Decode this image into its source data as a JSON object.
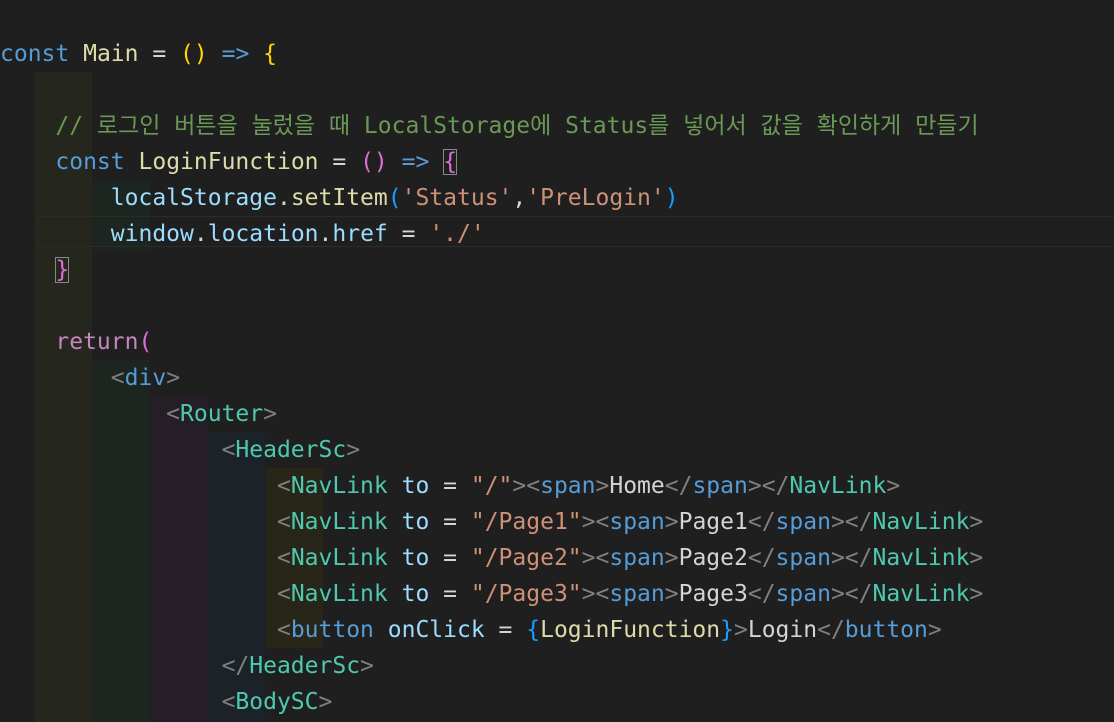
{
  "editor": {
    "lines": [
      {
        "indent": "",
        "tokens": [
          {
            "t": "const",
            "c": "kw"
          },
          {
            "t": " ",
            "c": "op"
          },
          {
            "t": "Main",
            "c": "fn"
          },
          {
            "t": " = ",
            "c": "op"
          },
          {
            "t": "()",
            "c": "b1"
          },
          {
            "t": " ",
            "c": "op"
          },
          {
            "t": "=>",
            "c": "kw"
          },
          {
            "t": " ",
            "c": "op"
          },
          {
            "t": "{",
            "c": "b1"
          }
        ]
      },
      {
        "indent": "",
        "tokens": []
      },
      {
        "indent": "    ",
        "tokens": [
          {
            "t": "// 로그인 버튼을 눌렀을 때 LocalStorage에 Status를 넣어서 값을 확인하게 만들기",
            "c": "com"
          }
        ]
      },
      {
        "indent": "    ",
        "tokens": [
          {
            "t": "const",
            "c": "kw"
          },
          {
            "t": " ",
            "c": "op"
          },
          {
            "t": "LoginFunction",
            "c": "fn"
          },
          {
            "t": " = ",
            "c": "op"
          },
          {
            "t": "()",
            "c": "b2"
          },
          {
            "t": " ",
            "c": "op"
          },
          {
            "t": "=>",
            "c": "kw"
          },
          {
            "t": " ",
            "c": "op"
          },
          {
            "t": "{",
            "c": "b2",
            "m": true
          }
        ]
      },
      {
        "indent": "        ",
        "tokens": [
          {
            "t": "localStorage",
            "c": "var"
          },
          {
            "t": ".",
            "c": "op"
          },
          {
            "t": "setItem",
            "c": "fn"
          },
          {
            "t": "(",
            "c": "b3"
          },
          {
            "t": "'Status'",
            "c": "str"
          },
          {
            "t": ",",
            "c": "op"
          },
          {
            "t": "'PreLogin'",
            "c": "str"
          },
          {
            "t": ")",
            "c": "b3"
          }
        ]
      },
      {
        "indent": "        ",
        "tokens": [
          {
            "t": "window",
            "c": "var"
          },
          {
            "t": ".",
            "c": "op"
          },
          {
            "t": "location",
            "c": "var"
          },
          {
            "t": ".",
            "c": "op"
          },
          {
            "t": "href",
            "c": "var"
          },
          {
            "t": " = ",
            "c": "op"
          },
          {
            "t": "'./'",
            "c": "str"
          }
        ]
      },
      {
        "indent": "    ",
        "tokens": [
          {
            "t": "}",
            "c": "b2",
            "m": true
          }
        ]
      },
      {
        "indent": "",
        "tokens": []
      },
      {
        "indent": "    ",
        "tokens": [
          {
            "t": "return",
            "c": "ctrl"
          },
          {
            "t": "(",
            "c": "b2"
          }
        ]
      },
      {
        "indent": "        ",
        "tokens": [
          {
            "t": "<",
            "c": "punc"
          },
          {
            "t": "div",
            "c": "tag"
          },
          {
            "t": ">",
            "c": "punc"
          }
        ]
      },
      {
        "indent": "            ",
        "tokens": [
          {
            "t": "<",
            "c": "punc"
          },
          {
            "t": "Router",
            "c": "comp"
          },
          {
            "t": ">",
            "c": "punc"
          }
        ]
      },
      {
        "indent": "                ",
        "tokens": [
          {
            "t": "<",
            "c": "punc"
          },
          {
            "t": "HeaderSc",
            "c": "comp"
          },
          {
            "t": ">",
            "c": "punc"
          }
        ]
      },
      {
        "indent": "                    ",
        "tokens": [
          {
            "t": "<",
            "c": "punc"
          },
          {
            "t": "NavLink",
            "c": "comp"
          },
          {
            "t": " ",
            "c": "op"
          },
          {
            "t": "to",
            "c": "var"
          },
          {
            "t": " = ",
            "c": "op"
          },
          {
            "t": "\"/\"",
            "c": "str"
          },
          {
            "t": "><",
            "c": "punc"
          },
          {
            "t": "span",
            "c": "tag"
          },
          {
            "t": ">",
            "c": "punc"
          },
          {
            "t": "Home",
            "c": "text"
          },
          {
            "t": "</",
            "c": "punc"
          },
          {
            "t": "span",
            "c": "tag"
          },
          {
            "t": "></",
            "c": "punc"
          },
          {
            "t": "NavLink",
            "c": "comp"
          },
          {
            "t": ">",
            "c": "punc"
          }
        ]
      },
      {
        "indent": "                    ",
        "tokens": [
          {
            "t": "<",
            "c": "punc"
          },
          {
            "t": "NavLink",
            "c": "comp"
          },
          {
            "t": " ",
            "c": "op"
          },
          {
            "t": "to",
            "c": "var"
          },
          {
            "t": " = ",
            "c": "op"
          },
          {
            "t": "\"/Page1\"",
            "c": "str"
          },
          {
            "t": "><",
            "c": "punc"
          },
          {
            "t": "span",
            "c": "tag"
          },
          {
            "t": ">",
            "c": "punc"
          },
          {
            "t": "Page1",
            "c": "text"
          },
          {
            "t": "</",
            "c": "punc"
          },
          {
            "t": "span",
            "c": "tag"
          },
          {
            "t": "></",
            "c": "punc"
          },
          {
            "t": "NavLink",
            "c": "comp"
          },
          {
            "t": ">",
            "c": "punc"
          }
        ]
      },
      {
        "indent": "                    ",
        "tokens": [
          {
            "t": "<",
            "c": "punc"
          },
          {
            "t": "NavLink",
            "c": "comp"
          },
          {
            "t": " ",
            "c": "op"
          },
          {
            "t": "to",
            "c": "var"
          },
          {
            "t": " = ",
            "c": "op"
          },
          {
            "t": "\"/Page2\"",
            "c": "str"
          },
          {
            "t": "><",
            "c": "punc"
          },
          {
            "t": "span",
            "c": "tag"
          },
          {
            "t": ">",
            "c": "punc"
          },
          {
            "t": "Page2",
            "c": "text"
          },
          {
            "t": "</",
            "c": "punc"
          },
          {
            "t": "span",
            "c": "tag"
          },
          {
            "t": "></",
            "c": "punc"
          },
          {
            "t": "NavLink",
            "c": "comp"
          },
          {
            "t": ">",
            "c": "punc"
          }
        ]
      },
      {
        "indent": "                    ",
        "tokens": [
          {
            "t": "<",
            "c": "punc"
          },
          {
            "t": "NavLink",
            "c": "comp"
          },
          {
            "t": " ",
            "c": "op"
          },
          {
            "t": "to",
            "c": "var"
          },
          {
            "t": " = ",
            "c": "op"
          },
          {
            "t": "\"/Page3\"",
            "c": "str"
          },
          {
            "t": "><",
            "c": "punc"
          },
          {
            "t": "span",
            "c": "tag"
          },
          {
            "t": ">",
            "c": "punc"
          },
          {
            "t": "Page3",
            "c": "text"
          },
          {
            "t": "</",
            "c": "punc"
          },
          {
            "t": "span",
            "c": "tag"
          },
          {
            "t": "></",
            "c": "punc"
          },
          {
            "t": "NavLink",
            "c": "comp"
          },
          {
            "t": ">",
            "c": "punc"
          }
        ]
      },
      {
        "indent": "                    ",
        "tokens": [
          {
            "t": "<",
            "c": "punc"
          },
          {
            "t": "button",
            "c": "tag"
          },
          {
            "t": " ",
            "c": "op"
          },
          {
            "t": "onClick",
            "c": "var"
          },
          {
            "t": " = ",
            "c": "op"
          },
          {
            "t": "{",
            "c": "b3"
          },
          {
            "t": "LoginFunction",
            "c": "fn"
          },
          {
            "t": "}",
            "c": "b3"
          },
          {
            "t": ">",
            "c": "punc"
          },
          {
            "t": "Login",
            "c": "text"
          },
          {
            "t": "</",
            "c": "punc"
          },
          {
            "t": "button",
            "c": "tag"
          },
          {
            "t": ">",
            "c": "punc"
          }
        ]
      },
      {
        "indent": "                ",
        "tokens": [
          {
            "t": "</",
            "c": "punc"
          },
          {
            "t": "HeaderSc",
            "c": "comp"
          },
          {
            "t": ">",
            "c": "punc"
          }
        ]
      },
      {
        "indent": "                ",
        "tokens": [
          {
            "t": "<",
            "c": "punc"
          },
          {
            "t": "BodySC",
            "c": "comp"
          },
          {
            "t": ">",
            "c": "punc"
          }
        ]
      }
    ]
  }
}
